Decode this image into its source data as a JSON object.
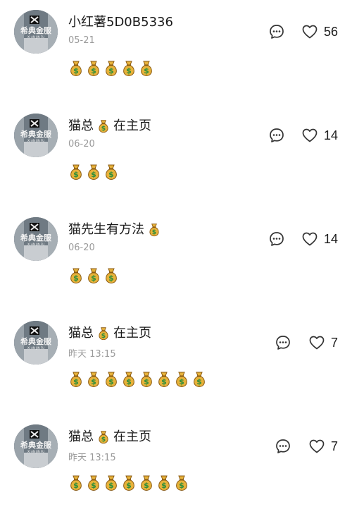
{
  "comments": [
    {
      "username": "小红薯5D0B5336",
      "username_tail": "",
      "username_has_bag": false,
      "timestamp": "05-21",
      "like_count": "56",
      "body_emoji": "money-bag",
      "body_emoji_count": 5
    },
    {
      "username": "猫总",
      "username_tail": "在主页",
      "username_has_bag": true,
      "timestamp": "06-20",
      "like_count": "14",
      "body_emoji": "money-bag",
      "body_emoji_count": 3
    },
    {
      "username": "猫先生有方法",
      "username_tail": "",
      "username_has_bag": true,
      "timestamp": "06-20",
      "like_count": "14",
      "body_emoji": "money-bag",
      "body_emoji_count": 3
    },
    {
      "username": "猫总",
      "username_tail": "在主页",
      "username_has_bag": true,
      "timestamp": "昨天 13:15",
      "like_count": "7",
      "body_emoji": "money-bag",
      "body_emoji_count": 8
    },
    {
      "username": "猫总",
      "username_tail": "在主页",
      "username_has_bag": true,
      "timestamp": "昨天 13:15",
      "like_count": "7",
      "body_emoji": "money-bag",
      "body_emoji_count": 7
    }
  ],
  "avatar_text": {
    "brand_cn": "希典金服",
    "brand_pinyin": "XI AN JIN FU"
  },
  "colors": {
    "name_text": "#1a1a1a",
    "meta_text": "#9a9a9a",
    "icon_stroke": "#333333",
    "bag_gold": "#e7b23a",
    "bag_dark": "#8a5a12",
    "dollar_green": "#2f8f3a"
  },
  "icons": {
    "reply": "comment-bubble-icon",
    "like": "heart-outline-icon",
    "emoji": "money-bag-emoji"
  }
}
